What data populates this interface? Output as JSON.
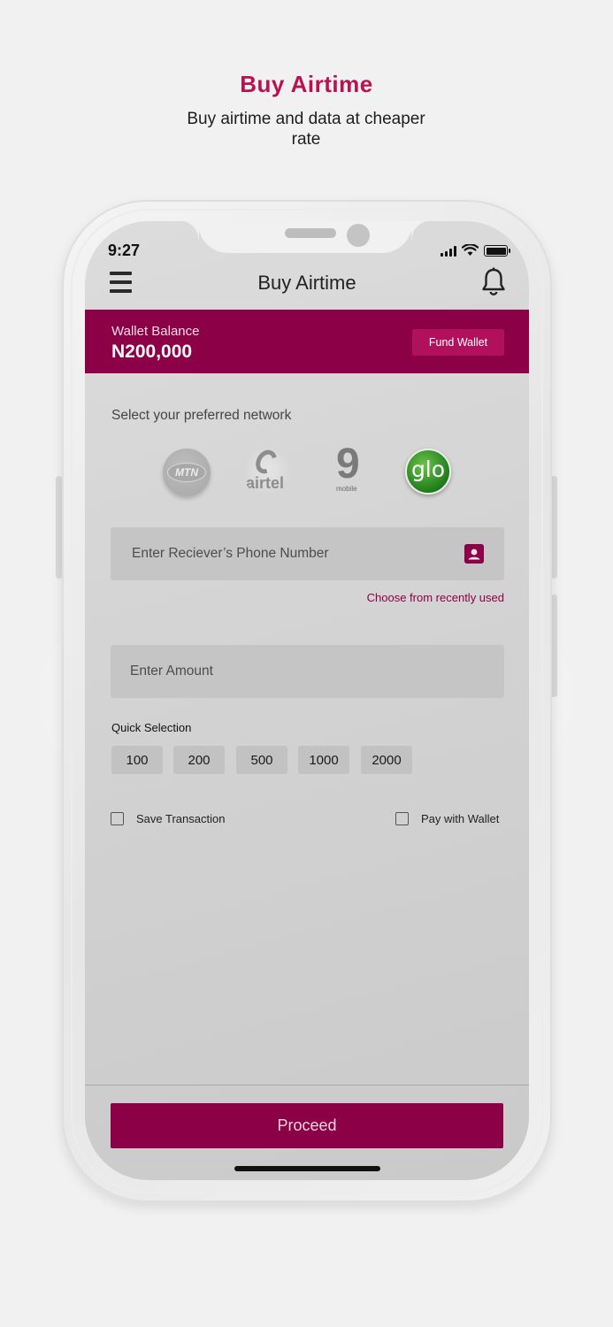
{
  "promo": {
    "title": "Buy Airtime",
    "subtitle": "Buy airtime and data at cheaper rate"
  },
  "status_bar": {
    "time": "9:27",
    "icons": [
      "signal-icon",
      "wifi-icon",
      "battery-icon"
    ]
  },
  "header": {
    "title": "Buy Airtime",
    "menu_icon": "menu-icon",
    "notification_icon": "bell-icon"
  },
  "wallet": {
    "label": "Wallet Balance",
    "balance": "N200,000",
    "fund_button": "Fund Wallet"
  },
  "network": {
    "prompt": "Select your preferred network",
    "providers": [
      {
        "name": "MTN",
        "logo_text": "MTN",
        "selected": false
      },
      {
        "name": "airtel",
        "logo_text": "airtel",
        "selected": false
      },
      {
        "name": "9mobile",
        "logo_text": "9",
        "logo_subtext": "mobile",
        "selected": false
      },
      {
        "name": "glo",
        "logo_text": "glo",
        "selected": true
      }
    ]
  },
  "phone_input": {
    "placeholder": "Enter Reciever’s Phone Number",
    "value": "",
    "contact_icon": "contact-book-icon",
    "recent_link": "Choose from recently used"
  },
  "amount_input": {
    "placeholder": "Enter Amount",
    "value": ""
  },
  "quick_selection": {
    "label": "Quick Selection",
    "options": [
      "100",
      "200",
      "500",
      "1000",
      "2000"
    ]
  },
  "options": {
    "save_transaction": {
      "label": "Save Transaction",
      "checked": false
    },
    "pay_with_wallet": {
      "label": "Pay with Wallet",
      "checked": false
    }
  },
  "footer": {
    "proceed_button": "Proceed"
  },
  "colors": {
    "brand": "#8b0046",
    "promo_title": "#b8124f",
    "glo_green": "#2a8f1f"
  }
}
